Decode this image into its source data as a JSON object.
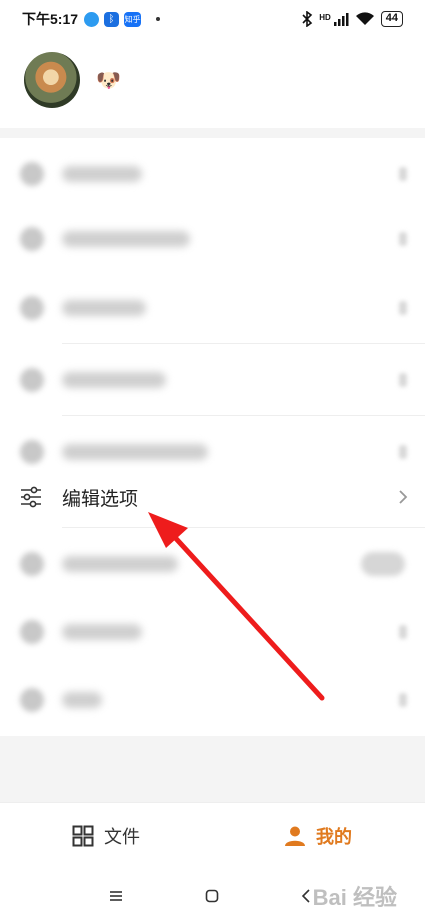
{
  "status_bar": {
    "time": "下午5:17",
    "app3_label": "知乎",
    "hd_label": "HD",
    "battery": "44"
  },
  "profile": {
    "nickname": "🐶"
  },
  "settings": {
    "edit_options_label": "编辑选项"
  },
  "tabbar": {
    "files_label": "文件",
    "mine_label": "我的",
    "active_color": "#e07a1f"
  },
  "watermark": "Bai 经验"
}
